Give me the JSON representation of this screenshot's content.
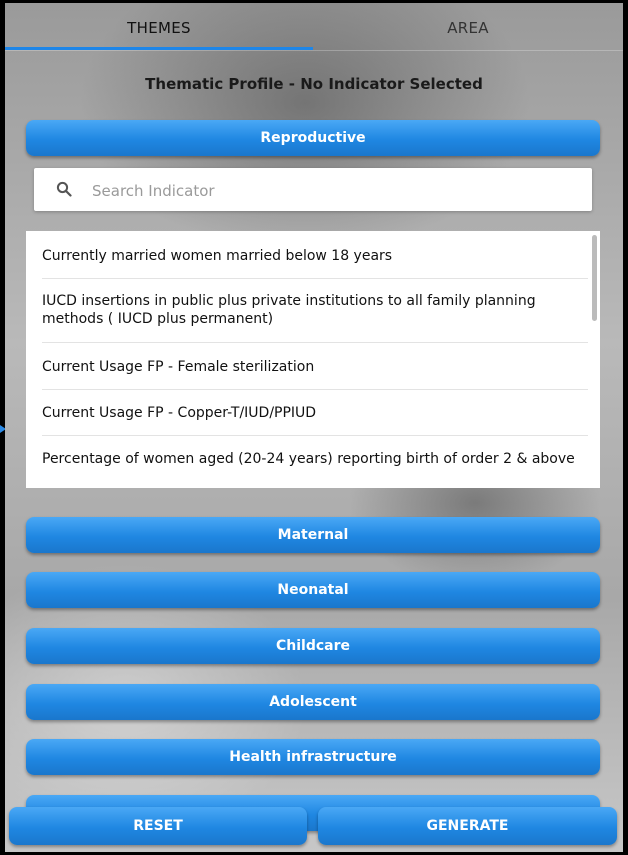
{
  "tabs": [
    {
      "label": "THEMES",
      "active": true
    },
    {
      "label": "AREA",
      "active": false
    }
  ],
  "profile_title": "Thematic Profile - No Indicator Selected",
  "reproductive": {
    "label": "Reproductive"
  },
  "search": {
    "placeholder": "Search Indicator",
    "icon": "search-icon"
  },
  "indicators": [
    "Currently married women married below 18 years",
    "IUCD insertions in public plus private institutions to all family planning methods ( IUCD plus permanent)",
    "Current Usage FP - Female sterilization",
    "Current Usage FP - Copper-T/IUD/PPIUD",
    "Percentage of women aged (20-24 years) reporting birth of order 2 & above"
  ],
  "themes": [
    "Maternal",
    "Neonatal",
    "Childcare",
    "Adolescent",
    "Health infrastructure"
  ],
  "actions": {
    "reset": "RESET",
    "generate": "GENERATE"
  },
  "colors": {
    "accent": "#1e86e8",
    "button_top": "#4aa8f5",
    "button_bottom": "#1a77cc"
  }
}
